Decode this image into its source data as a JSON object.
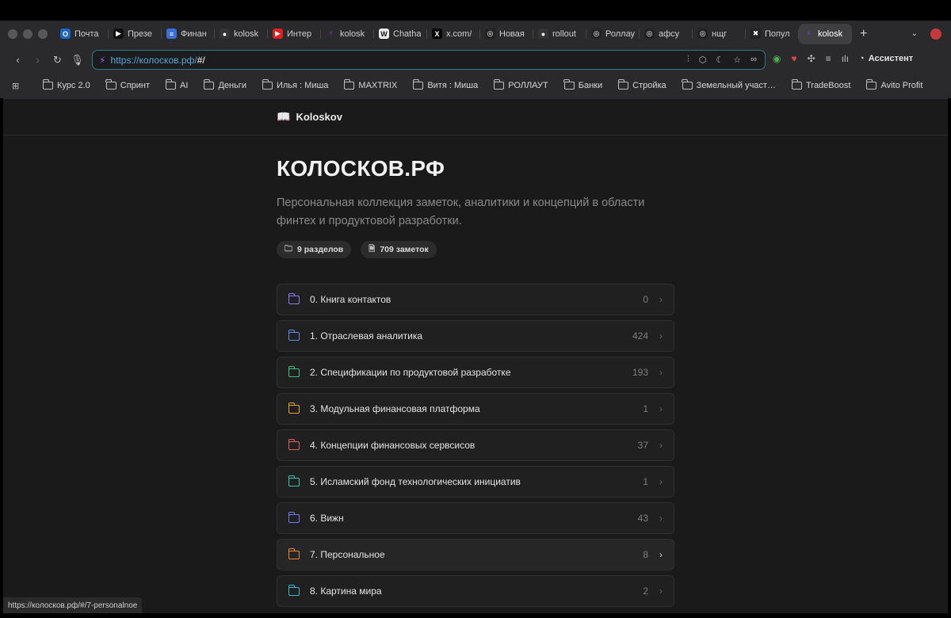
{
  "tabs": [
    {
      "label": "Почта",
      "icon": "outlook-icon",
      "color": "#1a66c9",
      "glyph": "O"
    },
    {
      "label": "Презе",
      "icon": "play-icon",
      "color": "#111111",
      "glyph": "▶"
    },
    {
      "label": "Финан",
      "icon": "docs-icon",
      "color": "#3b6fd8",
      "glyph": "≡"
    },
    {
      "label": "kolosk",
      "icon": "github-icon",
      "color": "#333333",
      "glyph": "●"
    },
    {
      "label": "Интер",
      "icon": "youtube-icon",
      "color": "#e02020",
      "glyph": "▶"
    },
    {
      "label": "kolosk",
      "icon": "lightning-icon",
      "color": "#7b3cff",
      "glyph": "⚡"
    },
    {
      "label": "Chatha",
      "icon": "wikipedia-icon",
      "color": "#eeeeee",
      "glyph": "W"
    },
    {
      "label": "x.com/",
      "icon": "x-icon",
      "color": "#000000",
      "glyph": "X"
    },
    {
      "label": "Новая",
      "icon": "openai-icon",
      "color": "#222222",
      "glyph": "◎"
    },
    {
      "label": "rollout",
      "icon": "github-icon",
      "color": "#333333",
      "glyph": "●"
    },
    {
      "label": "Роллау",
      "icon": "openai-icon",
      "color": "#222222",
      "glyph": "◎"
    },
    {
      "label": "афсу",
      "icon": "openai-icon",
      "color": "#222222",
      "glyph": "◎"
    },
    {
      "label": "нщг",
      "icon": "openai-icon",
      "color": "#222222",
      "glyph": "◎"
    },
    {
      "label": "Попул",
      "icon": "cross-icon",
      "color": "#222222",
      "glyph": "✖"
    },
    {
      "label": "kolosk",
      "icon": "lightning-icon",
      "color": "#7b3cff",
      "glyph": "⚡",
      "active": true
    }
  ],
  "address": {
    "url_base": "https://колосков.рф/",
    "url_hash": "#/"
  },
  "assistant_label": "Ассистент",
  "bookmarks": [
    "Курс 2.0",
    "Спринт",
    "AI",
    "Деньги",
    "Илья : Миша",
    "MAXTRIX",
    "Витя : Миша",
    "РОЛЛАУТ",
    "Банки",
    "Стройка",
    "Земельный участ…",
    "TradeBoost",
    "Avito Profit"
  ],
  "site": {
    "brand": "Koloskov",
    "title": "КОЛОСКОВ.РФ",
    "description": "Персональная коллекция заметок, аналитики и концепций в области финтех и продуктовой разработки.",
    "badges": [
      "9 разделов",
      "709 заметок"
    ]
  },
  "sections": [
    {
      "label": "0. Книга контактов",
      "count": "0",
      "color": "#8b7cf6"
    },
    {
      "label": "1. Отраслевая аналитика",
      "count": "424",
      "color": "#5b8def"
    },
    {
      "label": "2. Спецификации по продуктовой разработке",
      "count": "193",
      "color": "#3fbf7f"
    },
    {
      "label": "3. Модульная финансовая платформа",
      "count": "1",
      "color": "#e0a43a"
    },
    {
      "label": "4. Концепции финансовых сервсисов",
      "count": "37",
      "color": "#e06060"
    },
    {
      "label": "5. Исламский фонд технологических инициатив",
      "count": "1",
      "color": "#3cc6b5"
    },
    {
      "label": "6. Вижн",
      "count": "43",
      "color": "#6f7cf0"
    },
    {
      "label": "7. Персональное",
      "count": "8",
      "color": "#e8873a",
      "hover": true
    },
    {
      "label": "8. Картина мира",
      "count": "2",
      "color": "#3ab6d6"
    }
  ],
  "status_url": "https://колосков.рф/#/7-personalnoe"
}
